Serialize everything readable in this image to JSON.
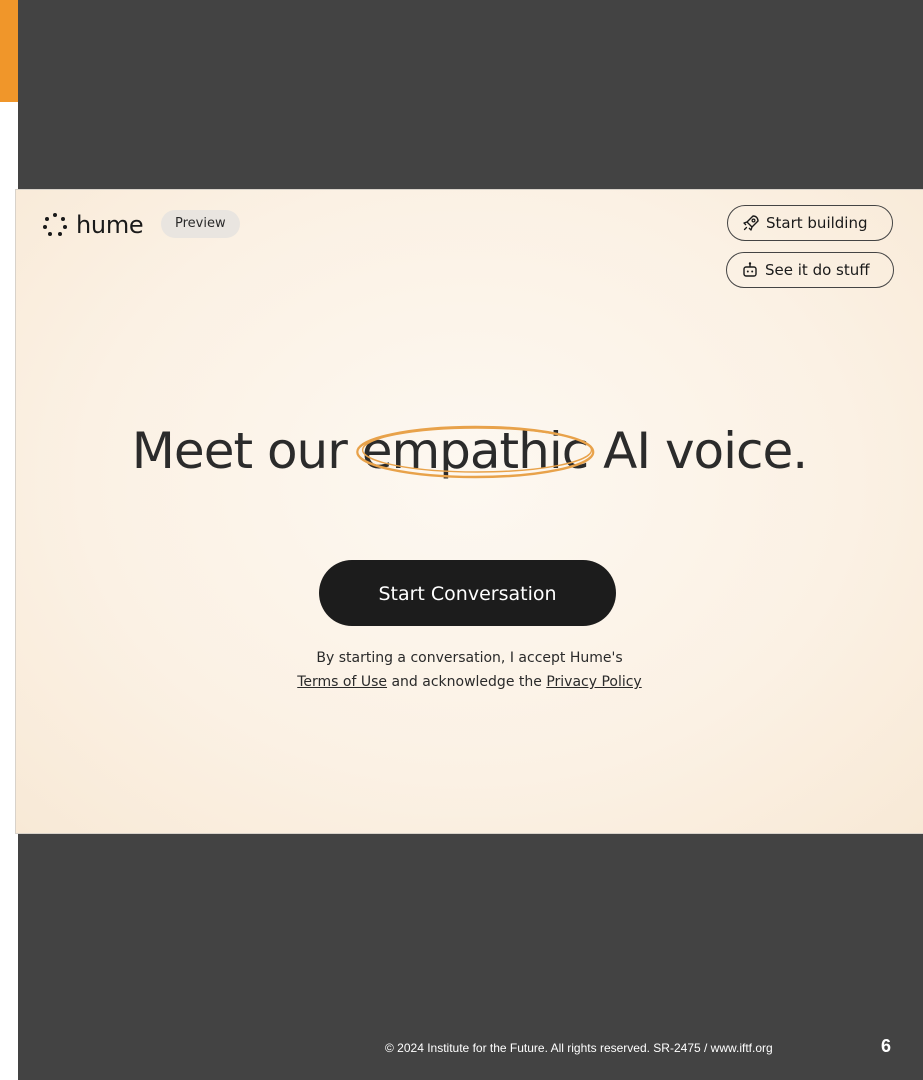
{
  "colors": {
    "slide_background": "#434343",
    "accent_bar": "#f0962a",
    "highlight_ellipse": "#e8a24a",
    "cta_background": "#1c1c1c"
  },
  "app": {
    "logo_text": "hume",
    "logo_icon": "dots-ring-icon",
    "badge": "Preview"
  },
  "header_buttons": {
    "start_building": {
      "label": "Start building",
      "icon": "rocket-icon"
    },
    "see_it_do_stuff": {
      "label": "See it do stuff",
      "icon": "robot-icon"
    }
  },
  "hero": {
    "headline_pre": "Meet our ",
    "headline_highlight": "empathic",
    "headline_post": " AI voice.",
    "cta_label": "Start Conversation"
  },
  "consent": {
    "line1": "By starting a conversation, I accept Hume's",
    "terms_link": "Terms of Use",
    "middle": " and acknowledge the ",
    "privacy_link": "Privacy Policy"
  },
  "footer": {
    "copyright": "© 2024 Institute for the Future. All rights reserved. SR-2475 / www.iftf.org",
    "page_number": "6"
  }
}
